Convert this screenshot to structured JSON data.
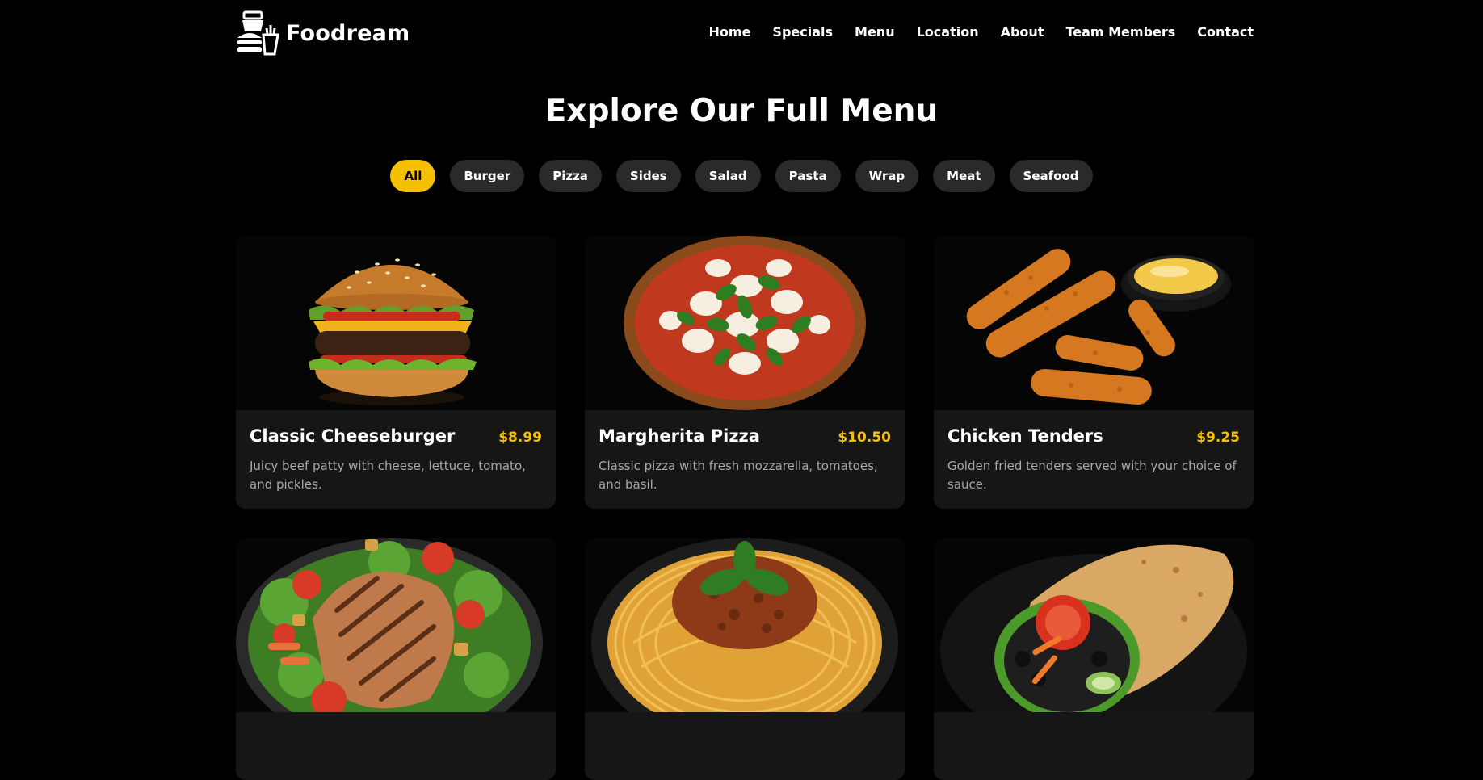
{
  "brand": {
    "name": "Foodream"
  },
  "nav": {
    "items": [
      "Home",
      "Specials",
      "Menu",
      "Location",
      "About",
      "Team Members",
      "Contact"
    ]
  },
  "page": {
    "title": "Explore Our Full Menu"
  },
  "filters": {
    "items": [
      "All",
      "Burger",
      "Pizza",
      "Sides",
      "Salad",
      "Pasta",
      "Wrap",
      "Meat",
      "Seafood"
    ],
    "active": "All"
  },
  "menu_items": [
    {
      "name": "Classic Cheeseburger",
      "price": "$8.99",
      "description": "Juicy beef patty with cheese, lettuce, tomato, and pickles.",
      "image": "cheeseburger-photo"
    },
    {
      "name": "Margherita Pizza",
      "price": "$10.50",
      "description": "Classic pizza with fresh mozzarella, tomatoes, and basil.",
      "image": "margherita-pizza-photo"
    },
    {
      "name": "Chicken Tenders",
      "price": "$9.25",
      "description": "Golden fried tenders served with your choice of sauce.",
      "image": "chicken-tenders-photo"
    },
    {
      "image": "grilled-chicken-salad-photo"
    },
    {
      "image": "spaghetti-bolognese-photo"
    },
    {
      "image": "veggie-wrap-photo"
    }
  ],
  "colors": {
    "accent": "#f5c000",
    "background": "#000000",
    "card": "#161616",
    "pill": "#2a2a2a"
  }
}
